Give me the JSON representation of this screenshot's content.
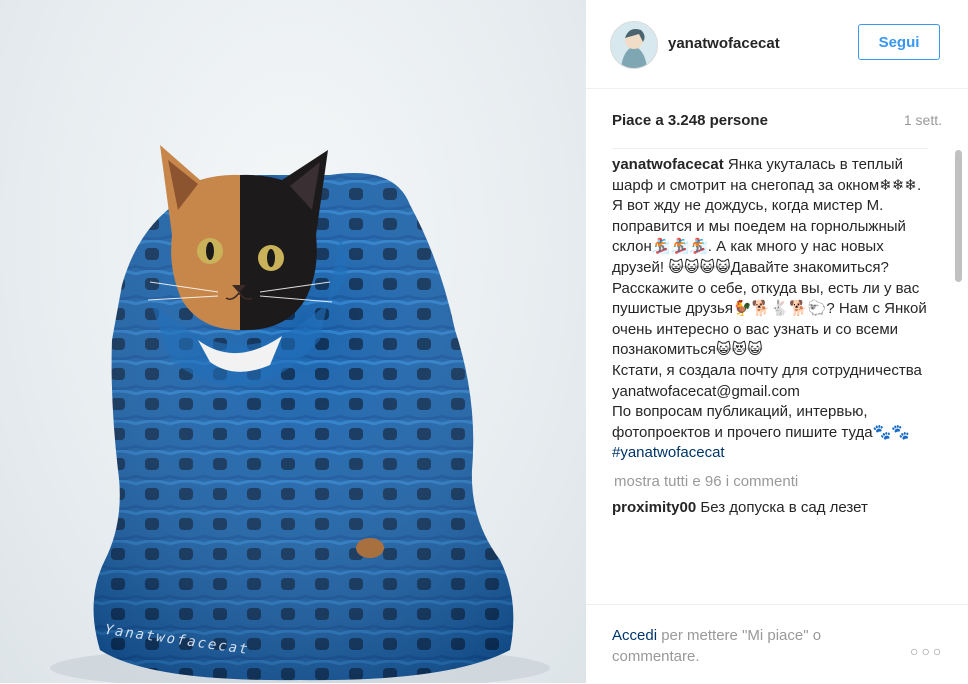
{
  "photo": {
    "watermark": "Yanatwofacecat",
    "subject_icon": "cat-in-blue-scarf"
  },
  "header": {
    "username": "yanatwofacecat",
    "follow_label": "Segui",
    "avatar_icon": "avatar-icon"
  },
  "stats": {
    "likes": "Piace a 3.248 persone",
    "time": "1 sett."
  },
  "caption": {
    "username": "yanatwofacecat",
    "text": " Янка укуталась в теплый шарф и смотрит на снегопад за окном❄❄❄. Я вот жду не дождусь, когда мистер М. поправится и мы поедем на горнолыжный склон🏂🏂🏂. А как много у нас новых друзей! 😺😺😺😺Давайте знакомиться? Расскажите о себе, откуда вы, есть ли у вас пушистые друзья🐓🐕🐇🐕🐑? Нам с Янкой очень интересно о вас узнать и со всеми познакомиться😺😻😺\nКстати, я создала почту для сотрудничества\nyanatwofacecat@gmail.com\nПо вопросам публикаций, интервью, фотопроектов и прочего пишите туда🐾🐾",
    "hashtag": "#yanatwofacecat"
  },
  "comments": {
    "show_all": "mostra tutti e 96 i commenti",
    "items": [
      {
        "username": "proximity00",
        "text": " Без допуска в сад лезет"
      }
    ]
  },
  "footer": {
    "login_link": "Accedi",
    "login_text": " per mettere \"Mi piace\" o commentare.",
    "more_icon": "more-options-icon",
    "more_glyph": "○○○"
  },
  "colors": {
    "accent": "#3897f0",
    "link": "#003569",
    "scarf": "#1a62a8"
  }
}
